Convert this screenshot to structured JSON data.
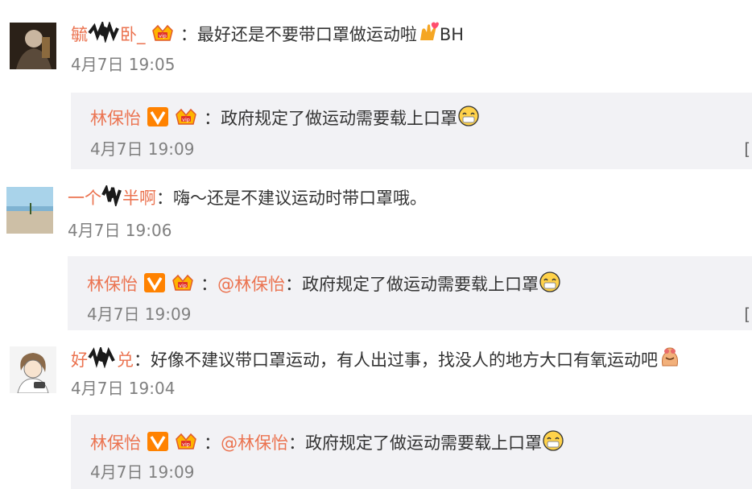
{
  "comments": [
    {
      "user": "毓",
      "user_tail": "卧_",
      "separator": "：",
      "text": "最好还是不要带口罩做运动啦",
      "text_tail": "BH",
      "time": "4月7日 19:05",
      "reply": {
        "user": "林保怡",
        "separator": "：",
        "mention": "",
        "text": "政府规定了做运动需要载上口罩",
        "time": "4月7日 19:09"
      }
    },
    {
      "user": "一个",
      "user_tail": "半啊",
      "separator": "：",
      "text": "嗨～还是不建议运动时带口罩哦。",
      "text_tail": "",
      "time": "4月7日 19:06",
      "reply": {
        "user": "林保怡",
        "separator": "：",
        "mention": "@林保怡",
        "text": "政府规定了做运动需要载上口罩",
        "time": "4月7日 19:09"
      }
    },
    {
      "user": "好",
      "user_tail": "兑",
      "separator": "：",
      "text": "好像不建议带口罩运动，有人出过事，找没人的地方大口有氧运动吧",
      "text_tail": "",
      "time": "4月7日 19:04",
      "reply": {
        "user": "林保怡",
        "separator": "：",
        "mention": "@林保怡",
        "text": "政府规定了做运动需要载上口罩",
        "time": "4月7日 19:09"
      }
    }
  ],
  "colors": {
    "username": "#eb7350",
    "timestamp": "#808080",
    "reply_background": "#f2f2f5",
    "verified_badge": "#ff8200"
  },
  "icons": [
    "vip-crown-icon",
    "verified-v-icon",
    "emoji-icon",
    "censor-scribble"
  ]
}
